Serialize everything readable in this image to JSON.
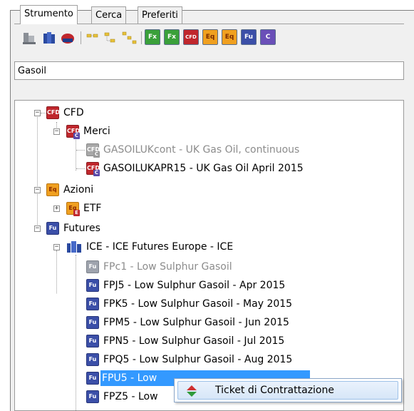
{
  "tabs": [
    "Strumento",
    "Cerca",
    "Preferiti"
  ],
  "toolbar": {
    "buttons": [
      {
        "icon": "stock-icon"
      },
      {
        "icon": "building-icon"
      },
      {
        "icon": "bull-icon"
      },
      {
        "icon": "tree-collapse-icon"
      },
      {
        "icon": "tree-level1-icon"
      },
      {
        "icon": "tree-level2-icon"
      },
      {
        "label": "Fx",
        "icon": "fx-icon",
        "color": "#3aa03a"
      },
      {
        "label": "Fx",
        "icon": "fx-c-icon",
        "color": "#3aa03a"
      },
      {
        "label": "CFD",
        "icon": "cfd-icon",
        "color": "#c0272d"
      },
      {
        "label": "Eq",
        "icon": "eq-icon",
        "color": "#f0a020"
      },
      {
        "label": "Eq",
        "icon": "eq-c-icon",
        "color": "#f0a020"
      },
      {
        "label": "Fu",
        "icon": "fu-icon",
        "color": "#3b4fa8"
      },
      {
        "label": "C",
        "icon": "c-icon",
        "color": "#6a4fb8"
      }
    ]
  },
  "search": {
    "value": "Gasoil"
  },
  "tree": {
    "cfd": "CFD",
    "merci": "Merci",
    "gas_cont": "GASOILUKcont - UK Gas Oil, continuous",
    "gas_apr": "GASOILUKAPR15 - UK Gas Oil April 2015",
    "azioni": "Azioni",
    "etf": "ETF",
    "futures": "Futures",
    "ice": "ICE - ICE Futures Europe - ICE",
    "items": [
      "FPc1 - Low Sulphur Gasoil",
      "FPJ5 - Low Sulphur Gasoil - Apr 2015",
      "FPK5 - Low Sulphur Gasoil - May 2015",
      "FPM5 - Low Sulphur Gasoil - Jun 2015",
      "FPN5 - Low Sulphur Gasoil - Jul 2015",
      "FPQ5 - Low Sulphur Gasoil - Aug 2015",
      "FPU5 - Low",
      "FPZ5 - Low"
    ],
    "icon_labels": {
      "cfd": "CFD",
      "eq": "Eq",
      "fu": "Fu"
    }
  },
  "context_menu": {
    "item": "Ticket di Contrattazione"
  }
}
